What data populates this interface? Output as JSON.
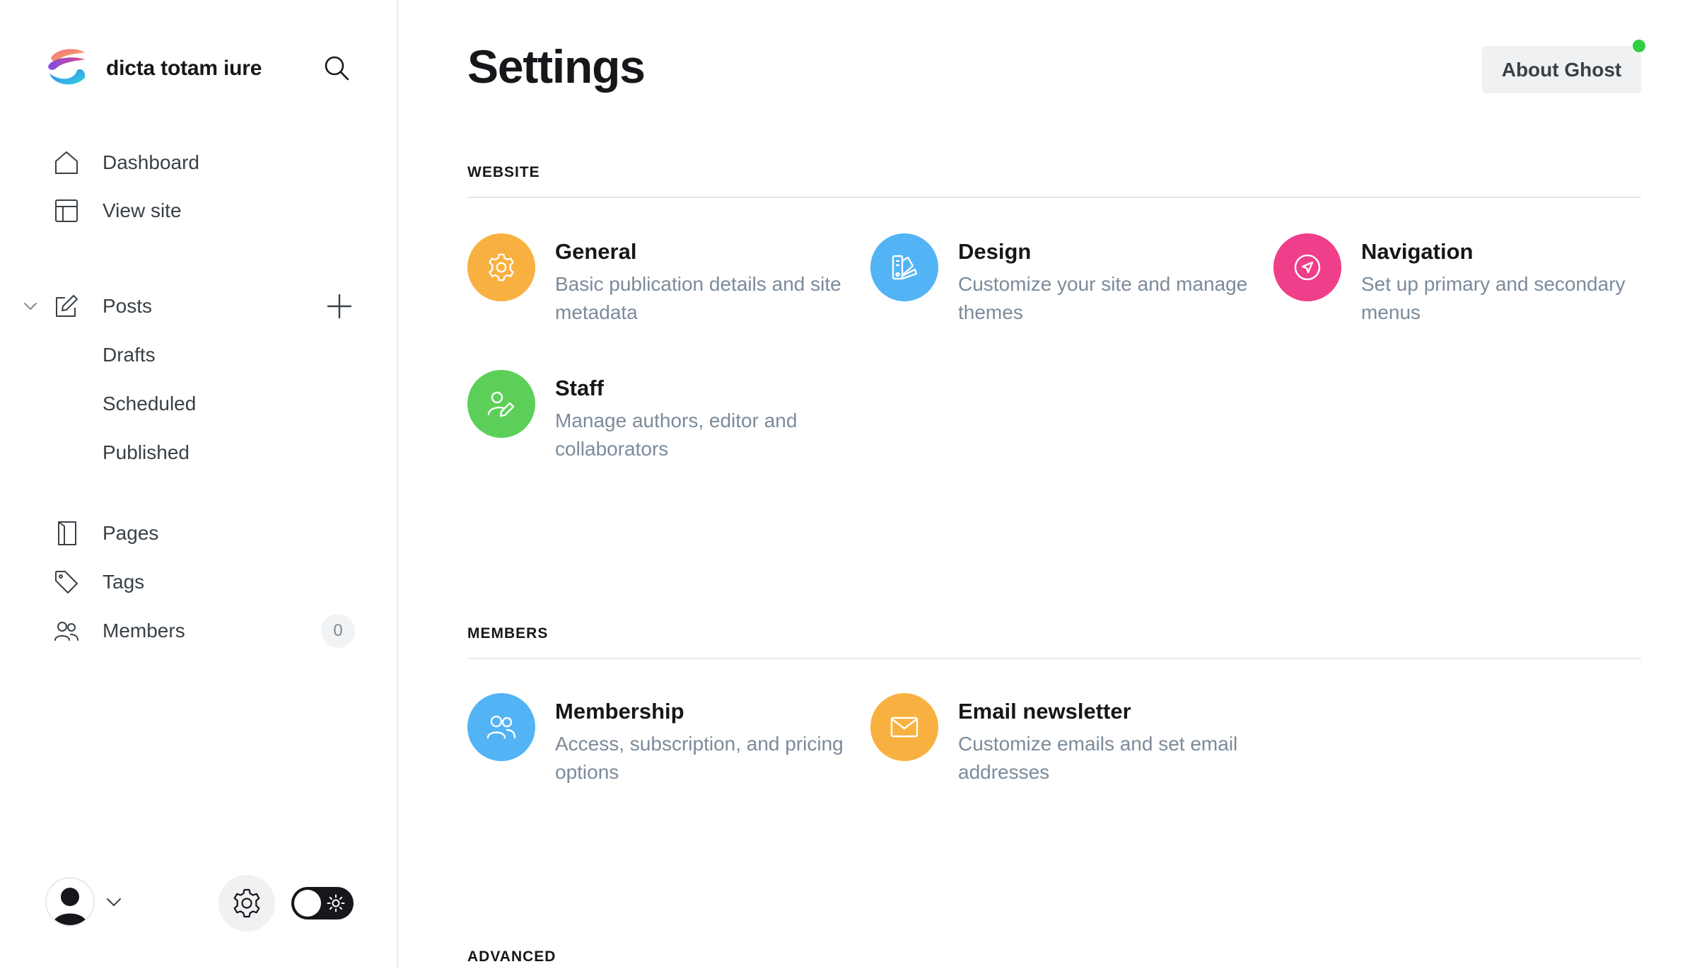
{
  "sidebar": {
    "site_name": "dicta totam iure",
    "nav": {
      "dashboard": "Dashboard",
      "view_site": "View site",
      "posts": "Posts",
      "drafts": "Drafts",
      "scheduled": "Scheduled",
      "published": "Published",
      "pages": "Pages",
      "tags": "Tags",
      "members": "Members",
      "members_count": "0"
    }
  },
  "main": {
    "title": "Settings",
    "about_button": "About Ghost",
    "sections": {
      "website": {
        "title": "WEBSITE",
        "cards": [
          {
            "title": "General",
            "description": "Basic publication details and site metadata",
            "icon": "gear-icon",
            "color": "#f8b140"
          },
          {
            "title": "Design",
            "description": "Customize your site and manage themes",
            "icon": "palette-icon",
            "color": "#52b3f5"
          },
          {
            "title": "Navigation",
            "description": "Set up primary and secondary menus",
            "icon": "compass-icon",
            "color": "#ef3e8a"
          },
          {
            "title": "Staff",
            "description": "Manage authors, editor and collaborators",
            "icon": "staff-edit-icon",
            "color": "#5ccf59"
          }
        ]
      },
      "members": {
        "title": "MEMBERS",
        "cards": [
          {
            "title": "Membership",
            "description": "Access, subscription, and pricing options",
            "icon": "users-icon",
            "color": "#52b3f5"
          },
          {
            "title": "Email newsletter",
            "description": "Customize emails and set email addresses",
            "icon": "envelope-icon",
            "color": "#f8b140"
          }
        ]
      },
      "advanced": {
        "title": "ADVANCED"
      }
    }
  },
  "colors": {
    "text_primary": "#15171a",
    "text_muted": "#7c8b9a",
    "status_green": "#30cf43"
  }
}
